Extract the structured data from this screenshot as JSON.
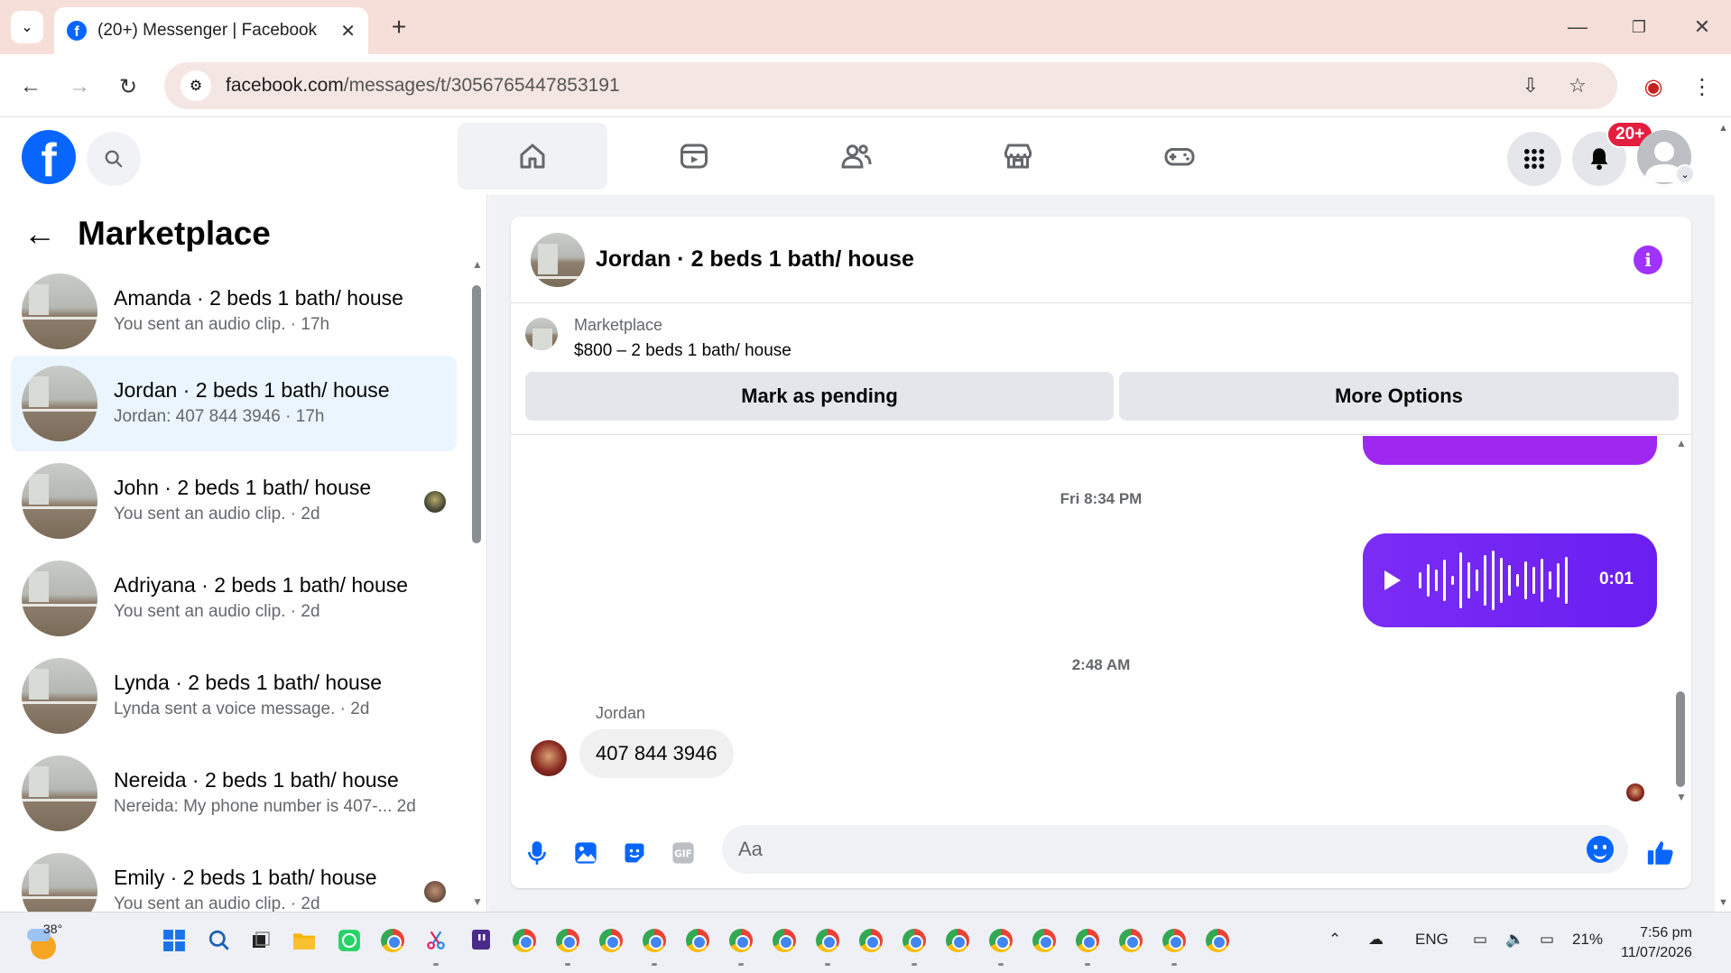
{
  "browser": {
    "tab_title": "(20+) Messenger | Facebook",
    "url_domain": "facebook.com",
    "url_path": "/messages/t/3056765447853191"
  },
  "fb_nav": {
    "notification_badge": "20+"
  },
  "sidebar": {
    "title": "Marketplace",
    "conversations": [
      {
        "name": "Amanda · 2 beds 1 bath/ house",
        "preview": "You sent an audio clip. · 17h",
        "active": false
      },
      {
        "name": "Jordan · 2 beds 1 bath/ house",
        "preview": "Jordan: 407 844 3946 · 17h",
        "active": true
      },
      {
        "name": "John · 2 beds 1 bath/ house",
        "preview": "You sent an audio clip. · 2d",
        "active": false
      },
      {
        "name": "Adriyana · 2 beds 1 bath/ house",
        "preview": "You sent an audio clip. · 2d",
        "active": false
      },
      {
        "name": "Lynda · 2 beds 1 bath/ house",
        "preview": "Lynda sent a voice message. · 2d",
        "active": false
      },
      {
        "name": "Nereida · 2 beds 1 bath/ house",
        "preview": "Nereida: My phone number is 407-...   2d",
        "active": false
      },
      {
        "name": "Emily · 2 beds 1 bath/ house",
        "preview": "You sent an audio clip. · 2d",
        "active": false
      }
    ]
  },
  "chat": {
    "title": "Jordan · 2 beds 1 bath/ house",
    "listing_label": "Marketplace",
    "listing_price": "$800 – 2 beds 1 bath/ house",
    "mark_pending_label": "Mark as pending",
    "more_options_label": "More Options",
    "timestamp_1": "Fri 8:34 PM",
    "audio_duration": "0:01",
    "timestamp_2": "2:48 AM",
    "sender_name": "Jordan",
    "incoming_message": "407 844 3946",
    "composer_placeholder": "Aa"
  },
  "taskbar": {
    "temperature": "38°",
    "language": "ENG",
    "battery": "21%",
    "time": "7:56 pm",
    "date": "11/07/2026"
  }
}
